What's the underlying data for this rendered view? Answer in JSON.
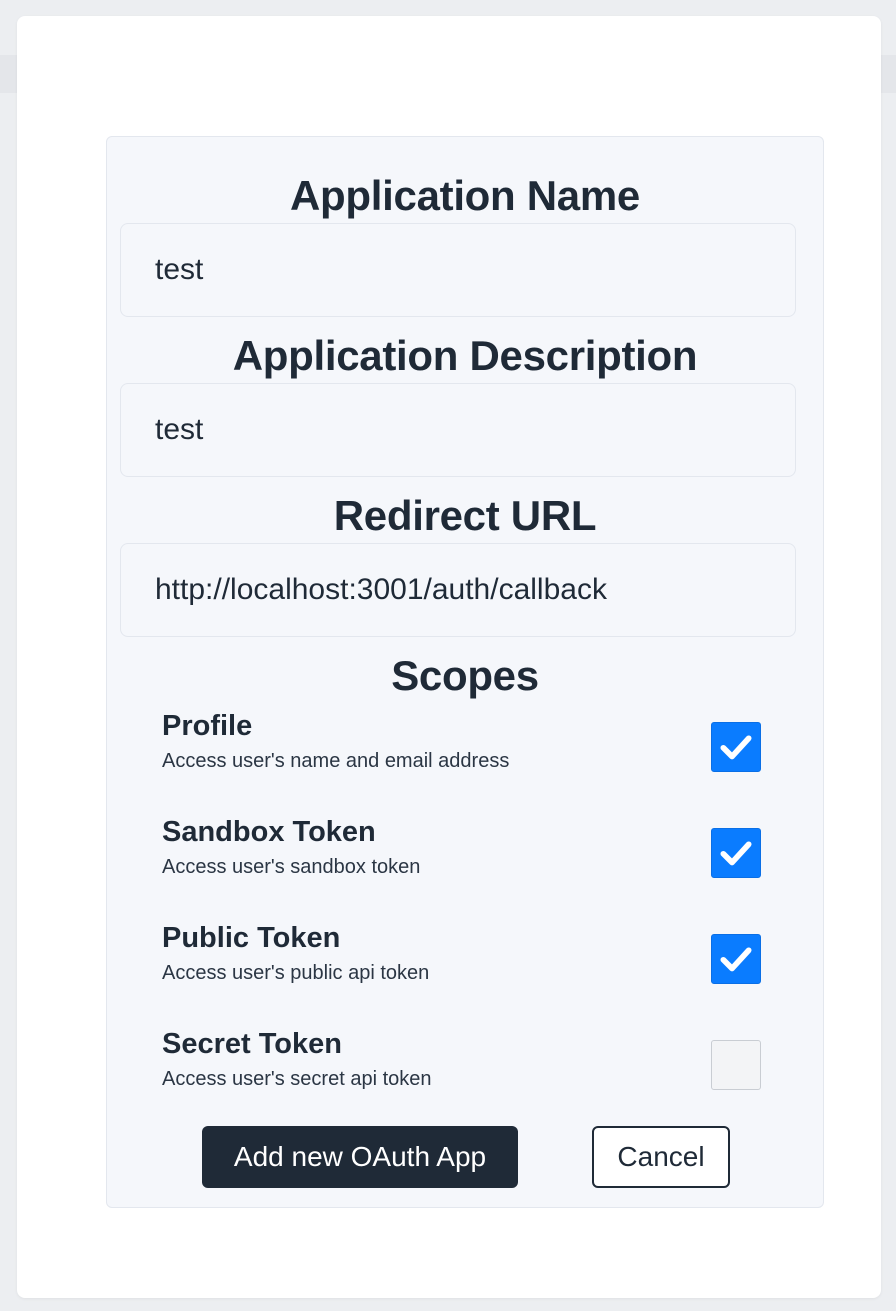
{
  "form": {
    "app_name": {
      "label": "Application Name",
      "value": "test"
    },
    "app_description": {
      "label": "Application Description",
      "value": "test"
    },
    "redirect_url": {
      "label": "Redirect URL",
      "value": "http://localhost:3001/auth/callback"
    },
    "scopes": {
      "heading": "Scopes",
      "items": [
        {
          "title": "Profile",
          "description": "Access user's name and email address",
          "checked": true
        },
        {
          "title": "Sandbox Token",
          "description": "Access user's sandbox token",
          "checked": true
        },
        {
          "title": "Public Token",
          "description": "Access user's public api token",
          "checked": true
        },
        {
          "title": "Secret Token",
          "description": "Access user's secret api token",
          "checked": false
        }
      ]
    },
    "actions": {
      "submit_label": "Add new OAuth App",
      "cancel_label": "Cancel"
    }
  },
  "colors": {
    "primary": "#1f2a37",
    "checkbox_accent": "#0a7cff",
    "panel_bg": "#f5f7fb"
  },
  "icons": {
    "checkmark": "checkmark-icon"
  }
}
